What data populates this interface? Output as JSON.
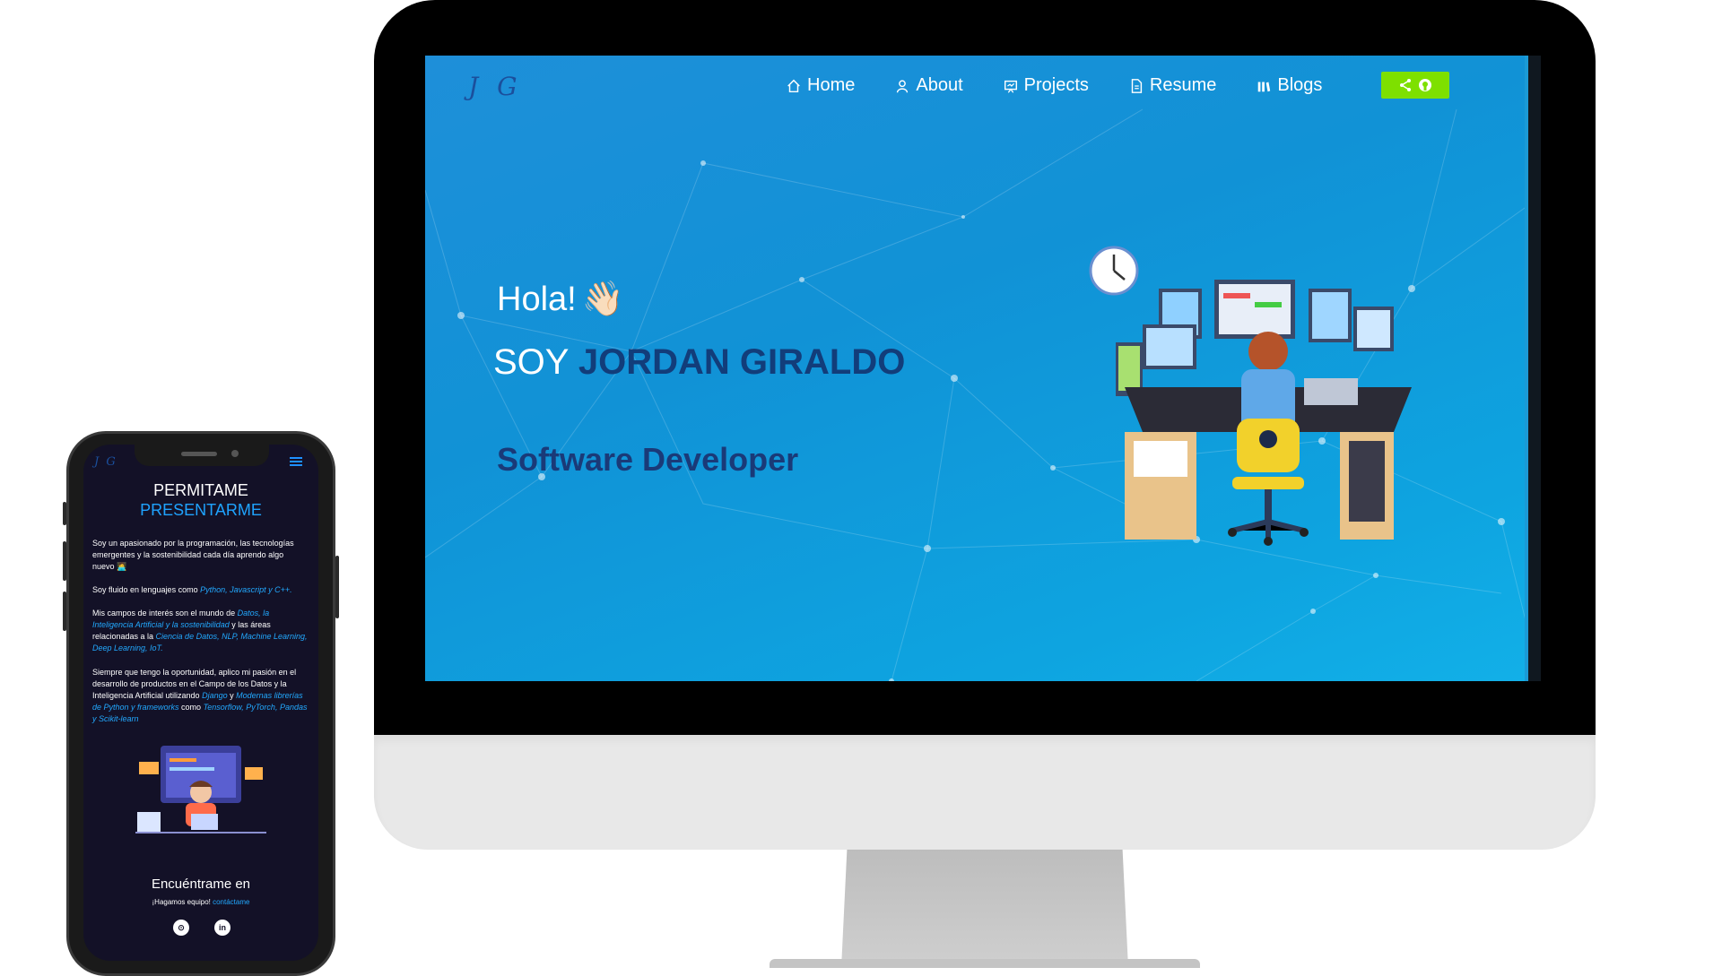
{
  "desktop": {
    "logo": "J G",
    "nav": [
      {
        "label": "Home",
        "icon": "home-icon"
      },
      {
        "label": "About",
        "icon": "user-icon"
      },
      {
        "label": "Projects",
        "icon": "projects-icon"
      },
      {
        "label": "Resume",
        "icon": "document-icon"
      },
      {
        "label": "Blogs",
        "icon": "library-icon"
      }
    ],
    "cta_icons": [
      "share-icon",
      "github-icon"
    ],
    "hero": {
      "greeting": "Hola!",
      "greeting_emoji": "👋🏻",
      "name_prefix": "SOY ",
      "name": "JORDAN GIRALDO",
      "role": "Software Developer"
    },
    "colors": {
      "accent": "#7ee000",
      "name": "#123d7a",
      "bg": "#1592d8"
    }
  },
  "phone": {
    "logo": "J G",
    "title_line1": "PERMITAME",
    "title_line2": "PRESENTARME",
    "p1": "Soy un apasionado por la programación, las tecnologías emergentes y la sostenibilidad cada día aprendo algo nuevo 🧑‍💻",
    "p2_pre": "Soy fluido en lenguajes como ",
    "p2_em": "Python, Javascript y C++.",
    "p3_pre": "Mis campos de interés son el mundo de ",
    "p3_em1": "Datos, la Inteligencia Artificial y la sostenibilidad",
    "p3_mid": " y las áreas relacionadas a la ",
    "p3_em2": "Ciencia de Datos, NLP, Machine Learning, Deep Learning, IoT.",
    "p4_pre": "Siempre que tengo la oportunidad, aplico mi pasión en el desarrollo de productos en el Campo de los Datos y la Inteligencia Artificial utilizando ",
    "p4_em1": "Django",
    "p4_mid1": " y ",
    "p4_em2": "Modernas librerías de Python y frameworks",
    "p4_mid2": " como ",
    "p4_em3": "Tensorflow, PyTorch, Pandas y Scikit-learn",
    "find_me": "Encuéntrame en",
    "cta_pre": "¡Hagamos equipo! ",
    "cta_link": "contáctame",
    "social": [
      "github-icon",
      "linkedin-icon"
    ],
    "social_labels": [
      "⊙",
      "in"
    ]
  }
}
